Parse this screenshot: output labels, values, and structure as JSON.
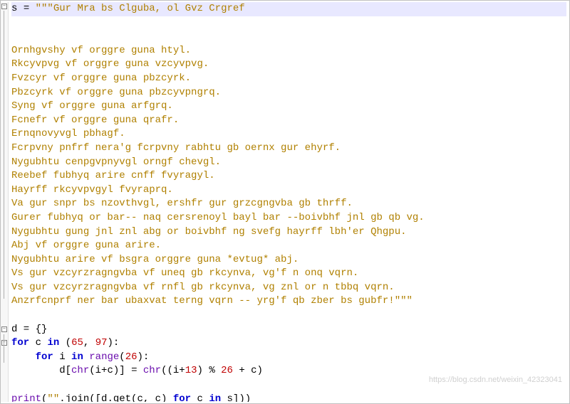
{
  "code": {
    "var_s": "s",
    "triple_quote": "\"\"\"",
    "s_lines": [
      "Gur Mra bs Clguba, ol Gvz Crgref",
      "",
      "Ornhgvshy vf orggre guna htyl.",
      "Rkcyvpvg vf orggre guna vzcyvpvg.",
      "Fvzcyr vf orggre guna pbzcyrk.",
      "Pbzcyrk vf orggre guna pbzcyvpngrq.",
      "Syng vf orggre guna arfgrq.",
      "Fcnefr vf orggre guna qrafr.",
      "Ernqnovyvgl pbhagf.",
      "Fcrpvny pnfrf nera'g fcrpvny rabhtu gb oernx gur ehyrf.",
      "Nygubhtu cenpgvpnyvgl orngf chevgl.",
      "Reebef fubhyq arire cnff fvyragyl.",
      "Hayrff rkcyvpvgyl fvyraprq.",
      "Va gur snpr bs nzovthvgl, ershfr gur grzcgngvba gb thrff.",
      "Gurer fubhyq or bar-- naq cersrenoyl bayl bar --boivbhf jnl gb qb vg.",
      "Nygubhtu gung jnl znl abg or boivbhf ng svefg hayrff lbh'er Qhgpu.",
      "Abj vf orggre guna arire.",
      "Nygubhtu arire vf bsgra orggre guna *evtug* abj.",
      "Vs gur vzcyrzragngvba vf uneq gb rkcynva, vg'f n onq vqrn.",
      "Vs gur vzcyrzragngvba vf rnfl gb rkcynva, vg znl or n tbbq vqrn.",
      "Anzrfcnprf ner bar ubaxvat terng vqrn -- yrg'f qb zber bs gubfr!"
    ],
    "line_d": "d = {}",
    "kw_for": "for",
    "kw_in": "in",
    "outer_for_var": "c",
    "outer_for_iter_l": "(",
    "outer_for_iter_65": "65",
    "outer_for_iter_comma": ", ",
    "outer_for_iter_97": "97",
    "outer_for_iter_r": "):",
    "inner_for_var": "i",
    "inner_for_range": "range",
    "inner_for_range_l": "(",
    "inner_for_range_26": "26",
    "inner_for_range_r": "):",
    "body_lhs": "d[",
    "body_chr1": "chr",
    "body_chr1_arg": "(i+c)",
    "body_mid": "] = ",
    "body_chr2": "chr",
    "body_chr2_arg_l": "((i+",
    "body_chr2_13": "13",
    "body_chr2_arg_mid": ") % ",
    "body_chr2_26": "26",
    "body_chr2_arg_r": " + c)",
    "print": "print",
    "print_arg_l": "(",
    "print_arg_str_empty": "\"\"",
    "print_arg_join": ".join([d.get(c, c) ",
    "print_arg_r": " s])",
    "print_close": ")"
  },
  "watermark": "https://blog.csdn.net/weixin_42323041"
}
